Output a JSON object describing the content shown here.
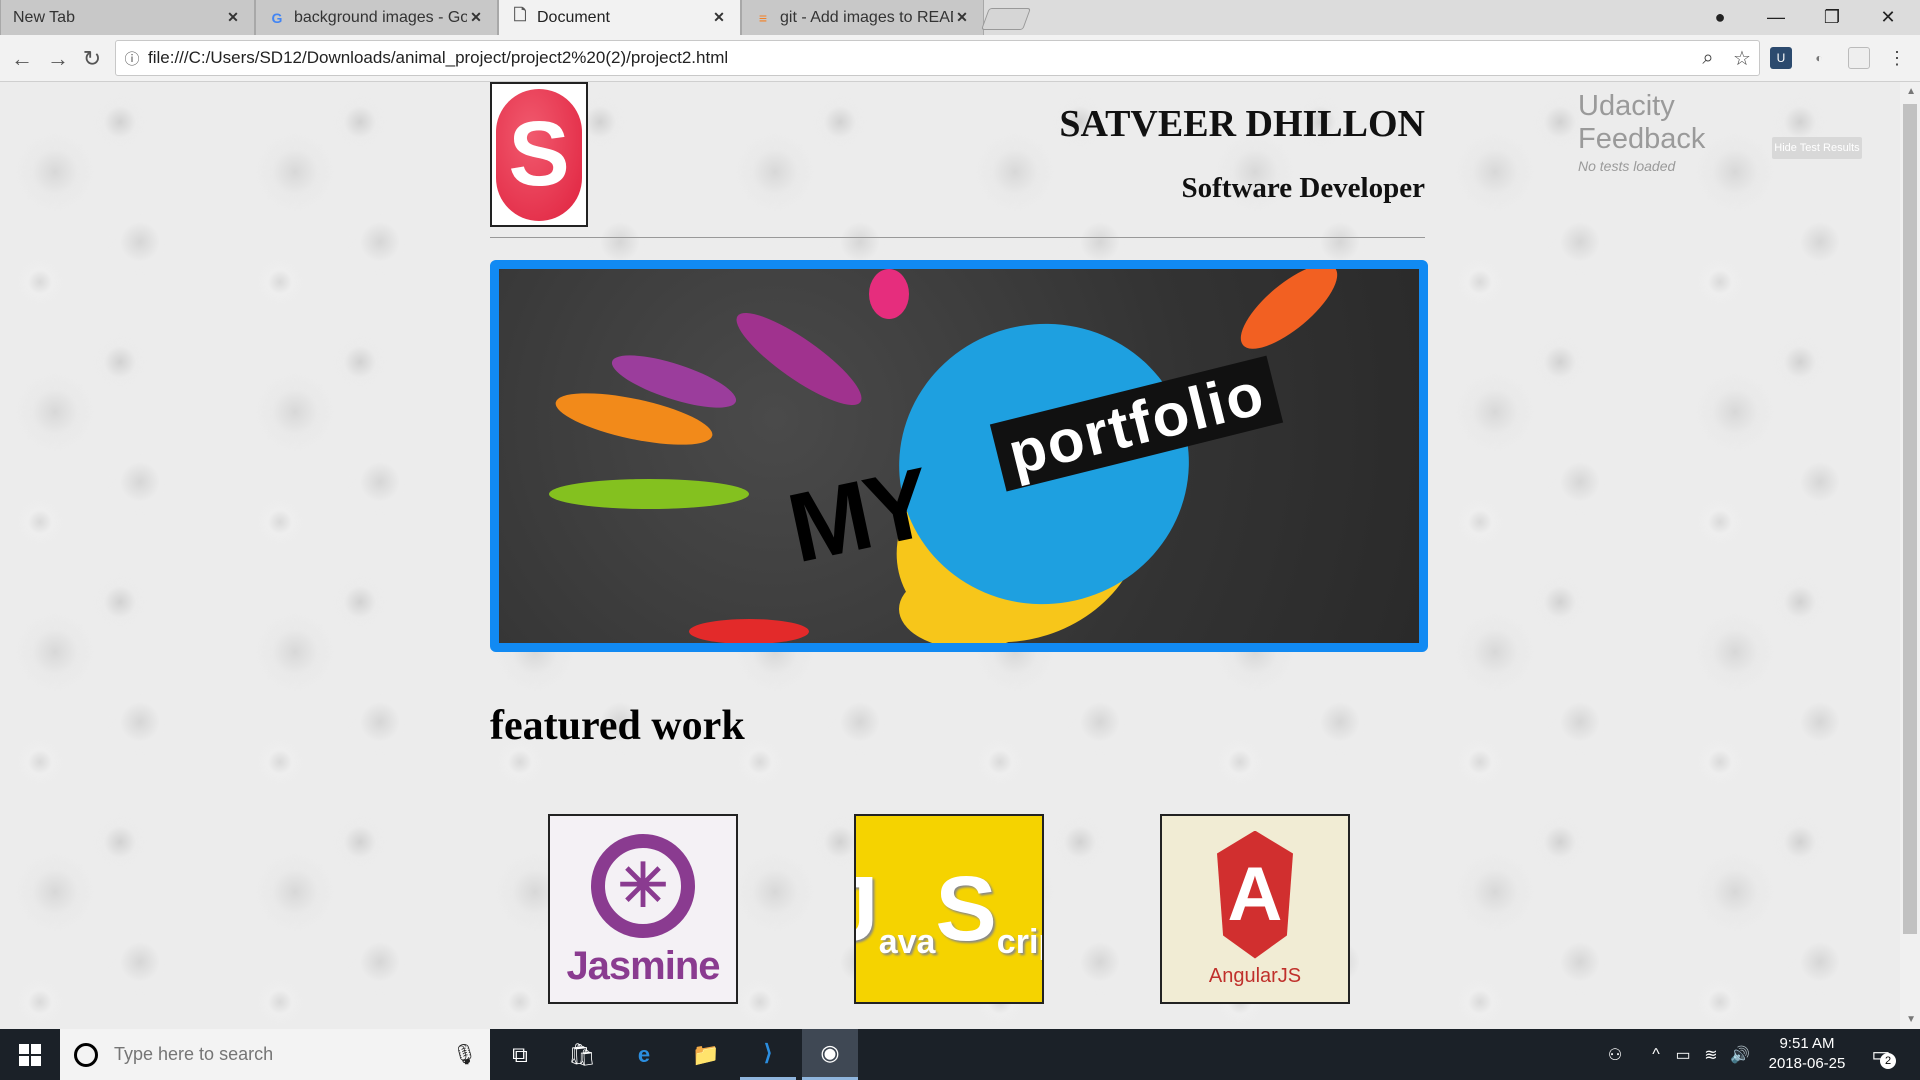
{
  "browser": {
    "tabs": [
      {
        "title": "New Tab",
        "favicon": "none"
      },
      {
        "title": "background images - Go",
        "favicon": "google-icon"
      },
      {
        "title": "Document",
        "favicon": "document-icon",
        "active": true
      },
      {
        "title": "git - Add images to READ",
        "favicon": "stackoverflow-icon"
      }
    ],
    "url": "file:///C:/Users/SD12/Downloads/animal_project/project2%20(2)/project2.html"
  },
  "page": {
    "logo_letter": "S",
    "name": "SATVEER DHILLON",
    "role": "Software Developer",
    "hero_my": "MY",
    "hero_portfolio": "portfolio",
    "featured_heading": "featured work",
    "cards": [
      {
        "label": "Jasmine"
      },
      {
        "j": "J",
        "s": "S",
        "ava": "ava",
        "cript": "cript"
      },
      {
        "letter": "A",
        "label": "AngularJS"
      }
    ]
  },
  "udacity": {
    "title": "Udacity Feedback",
    "status": "No tests loaded",
    "button": "Hide Test Results"
  },
  "taskbar": {
    "search_placeholder": "Type here to search",
    "time": "9:51 AM",
    "date": "2018-06-25",
    "notifications": "2"
  },
  "colors": {
    "hero_border": "#118af3",
    "jasmine": "#8a3b90",
    "javascript": "#f5d300",
    "angular": "#d12f2f"
  }
}
